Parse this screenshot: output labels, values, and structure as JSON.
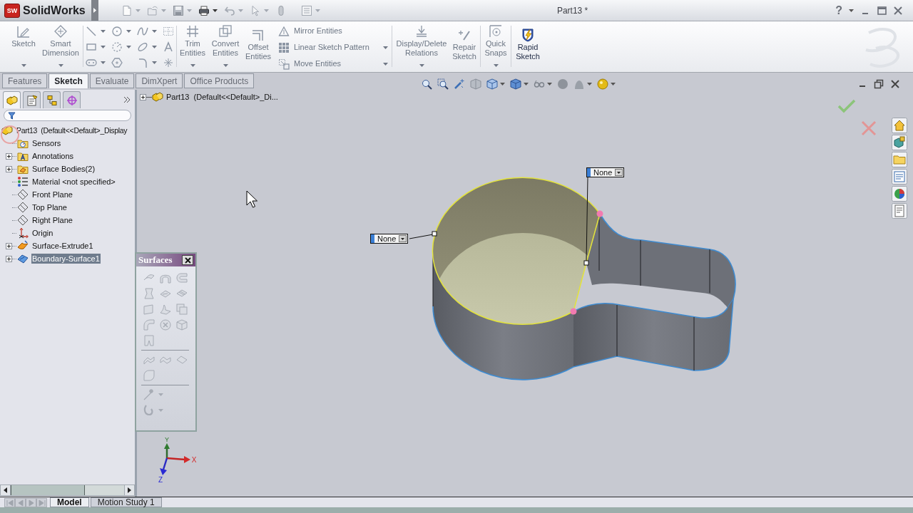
{
  "title_bar": {
    "logo_mark": "SW",
    "app_name": "SolidWorks",
    "document_title": "Part13 *",
    "help": "?"
  },
  "ribbon": {
    "groups": [
      [
        {
          "kind": "large",
          "label": "Sketch",
          "caret": true,
          "disabled": true
        },
        {
          "kind": "large",
          "label": "Smart Dimension",
          "caret": true,
          "disabled": true
        }
      ],
      [
        {
          "kind": "sketch_tools",
          "disabled": true
        }
      ],
      [
        {
          "kind": "large",
          "label": "Trim Entities",
          "caret": true,
          "disabled": true
        },
        {
          "kind": "large",
          "label": "Convert Entities",
          "caret": true,
          "disabled": true
        },
        {
          "kind": "large",
          "label": "Offset Entities",
          "caret": false,
          "disabled": true
        },
        {
          "kind": "stack",
          "rows": [
            {
              "label": "Mirror Entities",
              "caret": false,
              "disabled": true
            },
            {
              "label": "Linear Sketch Pattern",
              "caret": true,
              "disabled": true
            },
            {
              "label": "Move Entities",
              "caret": true,
              "disabled": true
            }
          ]
        }
      ],
      [
        {
          "kind": "large",
          "label": "Display/Delete Relations",
          "caret": true,
          "disabled": true
        },
        {
          "kind": "large",
          "label": "Repair Sketch",
          "caret": false,
          "disabled": true
        }
      ],
      [
        {
          "kind": "large",
          "label": "Quick Snaps",
          "caret": true,
          "disabled": true
        }
      ],
      [
        {
          "kind": "large",
          "label": "Rapid Sketch",
          "caret": false,
          "disabled": false
        }
      ]
    ]
  },
  "command_tabs": [
    {
      "label": "Features",
      "selected": false
    },
    {
      "label": "Sketch",
      "selected": true
    },
    {
      "label": "Evaluate",
      "selected": false
    },
    {
      "label": "DimXpert",
      "selected": false
    },
    {
      "label": "Office Products",
      "selected": false
    }
  ],
  "feature_manager": {
    "panel_tabs": [
      {
        "selected": true
      },
      {
        "selected": false
      },
      {
        "selected": false
      },
      {
        "selected": false
      }
    ],
    "tree": {
      "label": "Part13  (Default<<Default>_Display",
      "kind": "part",
      "collapsed": false,
      "selected": false,
      "children": [
        {
          "label": "Sensors",
          "kind": "sensors",
          "collapsed": false,
          "selected": false
        },
        {
          "label": "Annotations",
          "kind": "annotations",
          "collapsed": true,
          "selected": false
        },
        {
          "label": "Surface Bodies(2)",
          "kind": "bodies",
          "collapsed": true,
          "selected": false
        },
        {
          "label": "Material <not specified>",
          "kind": "material",
          "collapsed": false,
          "selected": false
        },
        {
          "label": "Front Plane",
          "kind": "plane",
          "collapsed": false,
          "selected": false
        },
        {
          "label": "Top Plane",
          "kind": "plane",
          "collapsed": false,
          "selected": false
        },
        {
          "label": "Right Plane",
          "kind": "plane",
          "collapsed": false,
          "selected": false
        },
        {
          "label": "Origin",
          "kind": "origin",
          "collapsed": false,
          "selected": false
        },
        {
          "label": "Surface-Extrude1",
          "kind": "extrude",
          "collapsed": true,
          "selected": false
        },
        {
          "label": "Boundary-Surface1",
          "kind": "boundary",
          "collapsed": true,
          "selected": true
        }
      ]
    }
  },
  "graphics_area": {
    "flyout_tree": {
      "label": "Part13  (Default<<Default>_Di...",
      "collapsed": true
    },
    "callouts": [
      {
        "value": "None"
      },
      {
        "value": "None"
      }
    ],
    "triad": {
      "x": "X",
      "y": "Y",
      "z": "Z"
    }
  },
  "surfaces_toolbar": {
    "title": "Surfaces",
    "tools_disabled": true
  },
  "bottom_tabs": [
    {
      "label": "Model",
      "selected": true
    },
    {
      "label": "Motion Study 1",
      "selected": false
    }
  ]
}
